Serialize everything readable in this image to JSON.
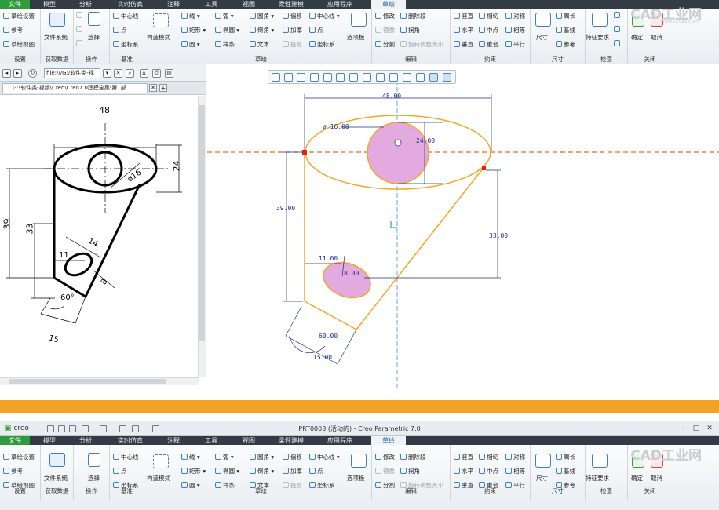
{
  "ribbon": {
    "tabs": [
      {
        "label": "文件"
      },
      {
        "label": "模型"
      },
      {
        "label": "分析"
      },
      {
        "label": "实时仿真"
      },
      {
        "label": "注释"
      },
      {
        "label": "工具"
      },
      {
        "label": "视图"
      },
      {
        "label": "柔性建模"
      },
      {
        "label": "应用程序"
      },
      {
        "label": "草绘"
      }
    ],
    "active_tab": "草绘",
    "groups": {
      "setup": {
        "label": "设置",
        "items": [
          "草绘设置",
          "参考",
          "草绘视图"
        ]
      },
      "get_data": {
        "label": "获取数据",
        "file_system": "文件系统"
      },
      "operations": {
        "label": "操作",
        "select": "选择"
      },
      "datum": {
        "label": "基准",
        "items": [
          "中心线",
          "点",
          "坐标系"
        ]
      },
      "construction": {
        "label": "构造模式"
      },
      "sketch": {
        "label": "草绘",
        "items": [
          "线",
          "弧",
          "圆角",
          "偏移",
          "中心线",
          "矩形",
          "椭圆",
          "倒角",
          "加厚",
          "点",
          "圆",
          "样条",
          "文本",
          "投影",
          "坐标系"
        ]
      },
      "palette": {
        "label": "选项板"
      },
      "edit": {
        "label": "编辑",
        "items": [
          "修改",
          "删除段",
          "镜像",
          "拐角",
          "分割",
          "旋转调整大小"
        ]
      },
      "constrain": {
        "label": "约束",
        "items": [
          "竖直",
          "相切",
          "对称",
          "水平",
          "中点",
          "相等",
          "垂直",
          "重合",
          "平行"
        ]
      },
      "dimension": {
        "label": "尺寸",
        "items": [
          "尺寸",
          "周长",
          "基线",
          "参考"
        ]
      },
      "inspect": {
        "label": "检查",
        "feature_requirements": "特征要求"
      },
      "close": {
        "label": "关闭",
        "ok": "确定",
        "cancel": "取消"
      }
    }
  },
  "browser": {
    "url": "file:///G:/软件类-视",
    "tab_label": "G:\\软件类-视频\\Creo\\Creo7.0建模全集\\第1部"
  },
  "reference_drawing": {
    "dims": [
      "48",
      "24",
      "ø16",
      "39",
      "33",
      "11",
      "14",
      "8",
      "60°",
      "15"
    ]
  },
  "sketch": {
    "dims": [
      "48.00",
      "ø 16.00",
      "24.00",
      "39.00",
      "33.00",
      "11.00",
      "8.00",
      "60.00",
      "15.00"
    ],
    "colors": {
      "sketch": "#f5a623",
      "dimension": "#1e2a8c",
      "fill": "#e3aadf",
      "centerline": "#e06a1c"
    }
  },
  "window": {
    "logo": "creo",
    "title": "PRT0003 (活动的) - Creo Parametric 7.0"
  },
  "watermark": {
    "text": "CAD工业网",
    "url": "www.zxcad.com"
  }
}
